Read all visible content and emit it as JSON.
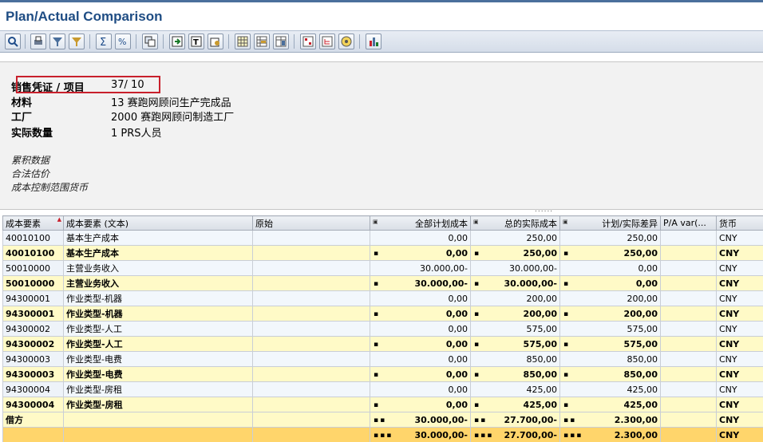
{
  "window": {
    "title": "Plan/Actual Comparison"
  },
  "toolbar": {
    "icons": [
      "detail-icon",
      "print-icon",
      "filter-set-icon",
      "filter-icon",
      "sum-icon",
      "subtotal-icon",
      "display-variant-icon",
      "export-icon",
      "text-icon",
      "local-file-icon",
      "table-view-icon",
      "grid-layout-icon",
      "column-layout-icon",
      "currency-icon",
      "hierarchy-icon",
      "info-icon",
      "graphic-icon"
    ]
  },
  "header": {
    "sales_doc_label": "销售凭证 / 项目",
    "sales_doc_value": "37/ 10",
    "material_label": "材料",
    "material_value": "13 赛跑网顾问生产完成品",
    "plant_label": "工厂",
    "plant_value": "2000 赛跑网顾问制造工厂",
    "actual_qty_label": "实际数量",
    "actual_qty_value": "1 PRS人员",
    "note1": "累积数据",
    "note2": "合法估价",
    "note3": "成本控制范围货币"
  },
  "columns": {
    "cost_element": "成本要素",
    "cost_element_text": "成本要素 (文本)",
    "origin": "原始",
    "total_plan": "全部计划成本",
    "total_actual": "总的实际成本",
    "variance": "计划/实际差异",
    "pa_var": "P/A var(...",
    "currency": "货币"
  },
  "rows": [
    {
      "type": "detail",
      "ce": "40010100",
      "text": "基本生产成本",
      "origin": "",
      "plan": "0,00",
      "actual": "250,00",
      "var": "250,00",
      "pa": "",
      "cur": "CNY"
    },
    {
      "type": "sub",
      "ce": "40010100",
      "text": "基本生产成本",
      "origin": "",
      "plan": "0,00",
      "actual": "250,00",
      "var": "250,00",
      "pa": "",
      "cur": "CNY"
    },
    {
      "type": "detail",
      "ce": "50010000",
      "text": "主营业务收入",
      "origin": "",
      "plan": "30.000,00-",
      "actual": "30.000,00-",
      "var": "0,00",
      "pa": "",
      "cur": "CNY"
    },
    {
      "type": "sub",
      "ce": "50010000",
      "text": "主营业务收入",
      "origin": "",
      "plan": "30.000,00-",
      "actual": "30.000,00-",
      "var": "0,00",
      "pa": "",
      "cur": "CNY"
    },
    {
      "type": "detail",
      "ce": "94300001",
      "text": "作业类型-机器",
      "origin": "",
      "plan": "0,00",
      "actual": "200,00",
      "var": "200,00",
      "pa": "",
      "cur": "CNY"
    },
    {
      "type": "sub",
      "ce": "94300001",
      "text": "作业类型-机器",
      "origin": "",
      "plan": "0,00",
      "actual": "200,00",
      "var": "200,00",
      "pa": "",
      "cur": "CNY"
    },
    {
      "type": "detail",
      "ce": "94300002",
      "text": "作业类型-人工",
      "origin": "",
      "plan": "0,00",
      "actual": "575,00",
      "var": "575,00",
      "pa": "",
      "cur": "CNY"
    },
    {
      "type": "sub",
      "ce": "94300002",
      "text": "作业类型-人工",
      "origin": "",
      "plan": "0,00",
      "actual": "575,00",
      "var": "575,00",
      "pa": "",
      "cur": "CNY"
    },
    {
      "type": "detail",
      "ce": "94300003",
      "text": "作业类型-电费",
      "origin": "",
      "plan": "0,00",
      "actual": "850,00",
      "var": "850,00",
      "pa": "",
      "cur": "CNY"
    },
    {
      "type": "sub",
      "ce": "94300003",
      "text": "作业类型-电费",
      "origin": "",
      "plan": "0,00",
      "actual": "850,00",
      "var": "850,00",
      "pa": "",
      "cur": "CNY"
    },
    {
      "type": "detail",
      "ce": "94300004",
      "text": "作业类型-房租",
      "origin": "",
      "plan": "0,00",
      "actual": "425,00",
      "var": "425,00",
      "pa": "",
      "cur": "CNY"
    },
    {
      "type": "sub",
      "ce": "94300004",
      "text": "作业类型-房租",
      "origin": "",
      "plan": "0,00",
      "actual": "425,00",
      "var": "425,00",
      "pa": "",
      "cur": "CNY"
    },
    {
      "type": "total",
      "ce": "借方",
      "text": "",
      "origin": "",
      "plan": "30.000,00-",
      "actual": "27.700,00-",
      "var": "2.300,00",
      "pa": "",
      "cur": "CNY"
    },
    {
      "type": "grand",
      "ce": "",
      "text": "",
      "origin": "",
      "plan": "30.000,00-",
      "actual": "27.700,00-",
      "var": "2.300,00",
      "pa": "",
      "cur": "CNY"
    }
  ]
}
